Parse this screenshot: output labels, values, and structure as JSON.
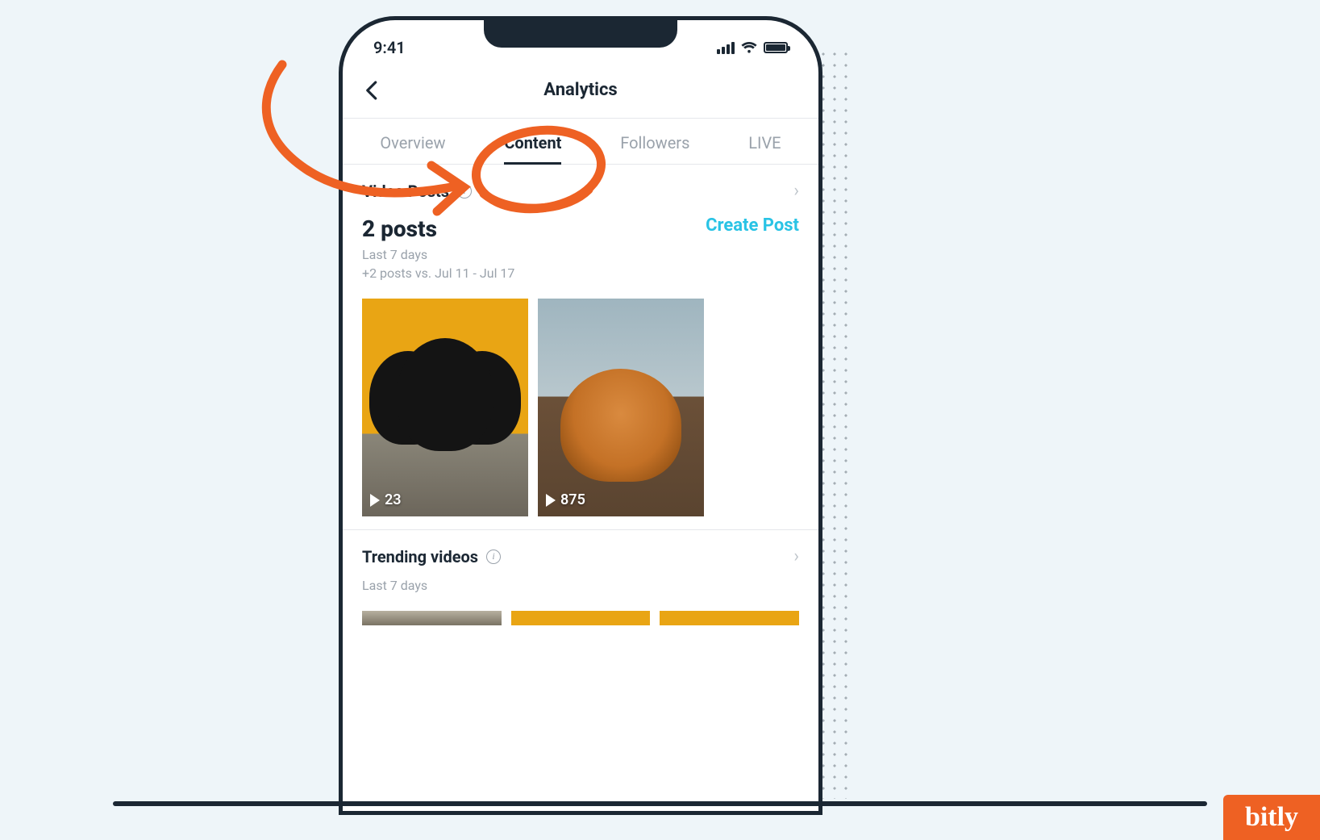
{
  "status": {
    "time": "9:41"
  },
  "header": {
    "title": "Analytics"
  },
  "tabs": [
    {
      "label": "Overview",
      "active": false
    },
    {
      "label": "Content",
      "active": true
    },
    {
      "label": "Followers",
      "active": false
    },
    {
      "label": "LIVE",
      "active": false
    }
  ],
  "video_posts": {
    "section_title": "Video Posts",
    "count_label": "2 posts",
    "create_label": "Create Post",
    "range_label": "Last 7 days",
    "delta_label": "+2 posts vs. Jul 11 - Jul 17",
    "items": [
      {
        "plays": "23"
      },
      {
        "plays": "875"
      }
    ]
  },
  "trending": {
    "section_title": "Trending videos",
    "range_label": "Last 7 days"
  },
  "brand": {
    "logo_text": "bitly"
  }
}
